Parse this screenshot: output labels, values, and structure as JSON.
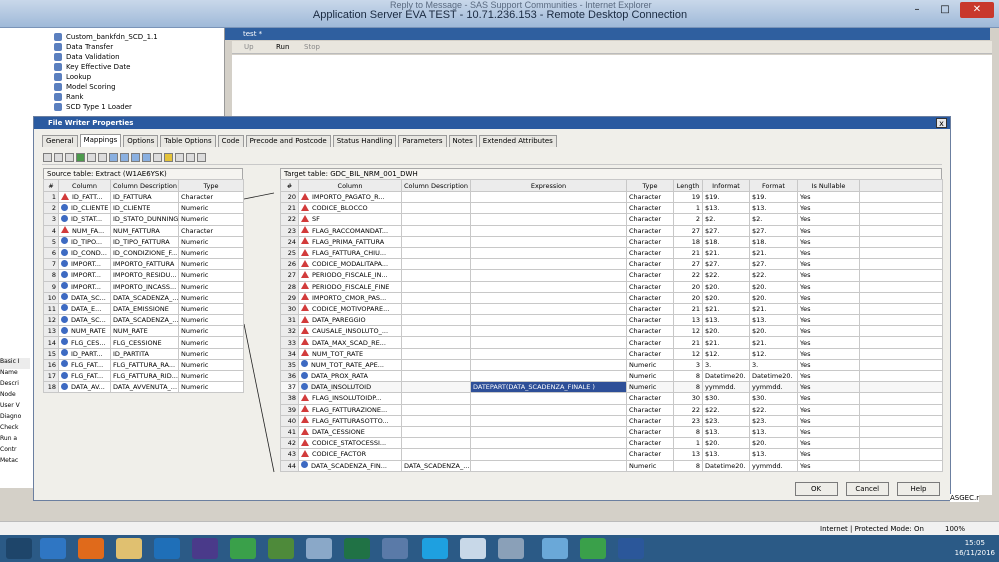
{
  "remote_desktop": {
    "title": "Application Server EVA TEST - 10.71.236.153 - Remote Desktop Connection",
    "ghost_title": "Reply to Message - SAS Support Communities - Internet Explorer",
    "minimize": "–",
    "maximize": "□",
    "close": "✕"
  },
  "tree": {
    "items": [
      "Custom_bankfdn_SCD_1.1",
      "Data Transfer",
      "Data Validation",
      "Key Effective Date",
      "Lookup",
      "Model Scoring",
      "Rank",
      "SCD Type 1 Loader"
    ]
  },
  "editor": {
    "tab_label": "test *",
    "up_label": "Up",
    "run_label": "Run",
    "stop_label": "Stop"
  },
  "dialog": {
    "title": "File Writer Properties",
    "close": "x",
    "tabs": [
      "General",
      "Mappings",
      "Options",
      "Table Options",
      "Code",
      "Precode and Postcode",
      "Status Handling",
      "Parameters",
      "Notes",
      "Extended Attributes"
    ],
    "active_tab": "Mappings",
    "source": {
      "caption": "Source table: Extract (W1AE6YSK)",
      "headers": [
        "#",
        "Column",
        "Column Description",
        "Type"
      ],
      "rows": [
        [
          "1",
          "ID_FATT...",
          "ID_FATTURA",
          "Character"
        ],
        [
          "2",
          "ID_CLIENTE",
          "ID_CLIENTE",
          "Numeric"
        ],
        [
          "3",
          "ID_STAT...",
          "ID_STATO_DUNNING",
          "Numeric"
        ],
        [
          "4",
          "NUM_FA...",
          "NUM_FATTURA",
          "Character"
        ],
        [
          "5",
          "ID_TIPO...",
          "ID_TIPO_FATTURA",
          "Numeric"
        ],
        [
          "6",
          "ID_COND...",
          "ID_CONDIZIONE_F...",
          "Numeric"
        ],
        [
          "7",
          "IMPORT...",
          "IMPORTO_FATTURA",
          "Numeric"
        ],
        [
          "8",
          "IMPORT...",
          "IMPORTO_RESIDU...",
          "Numeric"
        ],
        [
          "9",
          "IMPORT...",
          "IMPORTO_INCASS...",
          "Numeric"
        ],
        [
          "10",
          "DATA_SC...",
          "DATA_SCADENZA_...",
          "Numeric"
        ],
        [
          "11",
          "DATA_E...",
          "DATA_EMISSIONE",
          "Numeric"
        ],
        [
          "12",
          "DATA_SC...",
          "DATA_SCADENZA_...",
          "Numeric"
        ],
        [
          "13",
          "NUM_RATE",
          "NUM_RATE",
          "Numeric"
        ],
        [
          "14",
          "FLG_CES...",
          "FLG_CESSIONE",
          "Numeric"
        ],
        [
          "15",
          "ID_PART...",
          "ID_PARTITA",
          "Numeric"
        ],
        [
          "16",
          "FLG_FAT...",
          "FLG_FATTURA_RA...",
          "Numeric"
        ],
        [
          "17",
          "FLG_FAT...",
          "FLG_FATTURA_RID...",
          "Numeric"
        ],
        [
          "18",
          "DATA_AV...",
          "DATA_AVVENUTA_...",
          "Numeric"
        ]
      ]
    },
    "target": {
      "caption": "Target table: GDC_BIL_NRM_001_DWH",
      "headers": [
        "#",
        "Column",
        "Column Description",
        "Expression",
        "Type",
        "Length",
        "Informat",
        "Format",
        "Is Nullable"
      ],
      "rows": [
        [
          "20",
          "IMPORTO_PAGATO_R...",
          "",
          "",
          "Character",
          "19",
          "$19.",
          "$19.",
          "Yes"
        ],
        [
          "21",
          "CODICE_BLOCCO",
          "",
          "",
          "Character",
          "1",
          "$13.",
          "$13.",
          "Yes"
        ],
        [
          "22",
          "SF",
          "",
          "",
          "Character",
          "2",
          "$2.",
          "$2.",
          "Yes"
        ],
        [
          "23",
          "FLAG_RACCOMANDAT...",
          "",
          "",
          "Character",
          "27",
          "$27.",
          "$27.",
          "Yes"
        ],
        [
          "24",
          "FLAG_PRIMA_FATTURA",
          "",
          "",
          "Character",
          "18",
          "$18.",
          "$18.",
          "Yes"
        ],
        [
          "25",
          "FLAG_FATTURA_CHIU...",
          "",
          "",
          "Character",
          "21",
          "$21.",
          "$21.",
          "Yes"
        ],
        [
          "26",
          "CODICE_MODALITAPA...",
          "",
          "",
          "Character",
          "27",
          "$27.",
          "$27.",
          "Yes"
        ],
        [
          "27",
          "PERIODO_FISCALE_IN...",
          "",
          "",
          "Character",
          "22",
          "$22.",
          "$22.",
          "Yes"
        ],
        [
          "28",
          "PERIODO_FISCALE_FINE",
          "",
          "",
          "Character",
          "20",
          "$20.",
          "$20.",
          "Yes"
        ],
        [
          "29",
          "IMPORTO_CMOR_PAS...",
          "",
          "",
          "Character",
          "20",
          "$20.",
          "$20.",
          "Yes"
        ],
        [
          "30",
          "CODICE_MOTIVOPARE...",
          "",
          "",
          "Character",
          "21",
          "$21.",
          "$21.",
          "Yes"
        ],
        [
          "31",
          "DATA_PAREGGIO",
          "",
          "",
          "Character",
          "13",
          "$13.",
          "$13.",
          "Yes"
        ],
        [
          "32",
          "CAUSALE_INSOLUTO_...",
          "",
          "",
          "Character",
          "12",
          "$20.",
          "$20.",
          "Yes"
        ],
        [
          "33",
          "DATA_MAX_SCAD_RE...",
          "",
          "",
          "Character",
          "21",
          "$21.",
          "$21.",
          "Yes"
        ],
        [
          "34",
          "NUM_TOT_RATE",
          "",
          "",
          "Character",
          "12",
          "$12.",
          "$12.",
          "Yes"
        ],
        [
          "35",
          "NUM_TOT_RATE_APE...",
          "",
          "",
          "Numeric",
          "3",
          "3.",
          "3.",
          "Yes"
        ],
        [
          "36",
          "DATA_PROX_RATA",
          "",
          "",
          "Numeric",
          "8",
          "Datetime20.",
          "Datetime20.",
          "Yes"
        ],
        [
          "37",
          "DATA_INSOLUTOID",
          "",
          "DATEPART(DATA_SCADENZA_FINALE )",
          "Numeric",
          "8",
          "yymmdd.",
          "yymmdd.",
          "Yes"
        ],
        [
          "38",
          "FLAG_INSOLUTOIDP...",
          "",
          "",
          "Character",
          "30",
          "$30.",
          "$30.",
          "Yes"
        ],
        [
          "39",
          "FLAG_FATTURAZIONE...",
          "",
          "",
          "Character",
          "22",
          "$22.",
          "$22.",
          "Yes"
        ],
        [
          "40",
          "FLAG_FATTURASOTTO...",
          "",
          "",
          "Character",
          "23",
          "$23.",
          "$23.",
          "Yes"
        ],
        [
          "41",
          "DATA_CESSIONE",
          "",
          "",
          "Character",
          "8",
          "$13.",
          "$13.",
          "Yes"
        ],
        [
          "42",
          "CODICE_STATOCESSI...",
          "",
          "",
          "Character",
          "1",
          "$20.",
          "$20.",
          "Yes"
        ],
        [
          "43",
          "CODICE_FACTOR",
          "",
          "",
          "Character",
          "13",
          "$13.",
          "$13.",
          "Yes"
        ],
        [
          "44",
          "DATA_SCADENZA_FIN...",
          "DATA_SCADENZA_...",
          "",
          "Numeric",
          "8",
          "Datetime20.",
          "yymmdd.",
          "Yes"
        ]
      ]
    },
    "buttons": {
      "ok": "OK",
      "cancel": "Cancel",
      "help": "Help"
    }
  },
  "side_labels": [
    "Basic I",
    "Name",
    "Descri",
    "Node",
    "User V",
    "Diagno",
    "Check",
    "Run a",
    "Contr",
    "Metac"
  ],
  "status": {
    "zone": "Internet | Protected Mode: On",
    "zoom": "100%",
    "asgec": "ASGEC.r"
  },
  "taskbar": {
    "time": "15:05",
    "date": "16/11/2016"
  },
  "colors": {
    "dialog_title": "#2a5aa0",
    "taskbar": "#2b5a86",
    "selected_cell": "#2e4f98"
  }
}
